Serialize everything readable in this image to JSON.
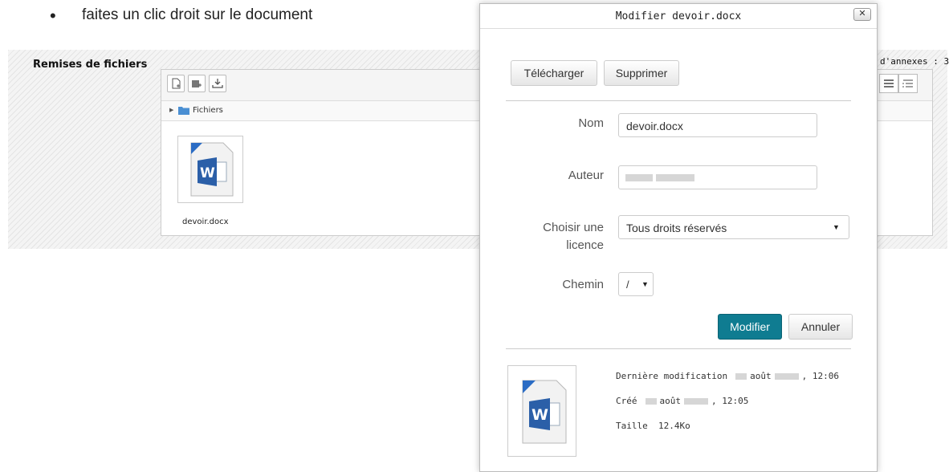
{
  "instruction": {
    "bullet": "•",
    "text": "faites un clic droit sur le document"
  },
  "filemanager": {
    "section_label": "Remises de fichiers",
    "attachments_label": "d'annexes : 3",
    "breadcrumb": "Fichiers",
    "file_name": "devoir.docx",
    "toolbar_icons": [
      "add-file-icon",
      "create-folder-icon",
      "download-icon"
    ],
    "view_icons": [
      "list-view-icon",
      "tree-view-icon"
    ]
  },
  "dialog": {
    "title": "Modifier devoir.docx",
    "close_glyph": "✕",
    "buttons": {
      "download": "Télécharger",
      "delete": "Supprimer",
      "update": "Modifier",
      "cancel": "Annuler"
    },
    "fields": {
      "name_label": "Nom",
      "name_value": "devoir.docx",
      "author_label": "Auteur",
      "license_label": "Choisir une licence",
      "license_value": "Tous droits réservés",
      "path_label": "Chemin",
      "path_value": "/"
    },
    "info": {
      "modified_label": "Dernière modification",
      "modified_month": "août",
      "modified_time": ", 12:06",
      "created_label": "Créé",
      "created_month": "août",
      "created_time": ", 12:05",
      "size_label": "Taille",
      "size_value": "12.4Ko"
    },
    "colors": {
      "primary": "#0f7c91"
    }
  }
}
